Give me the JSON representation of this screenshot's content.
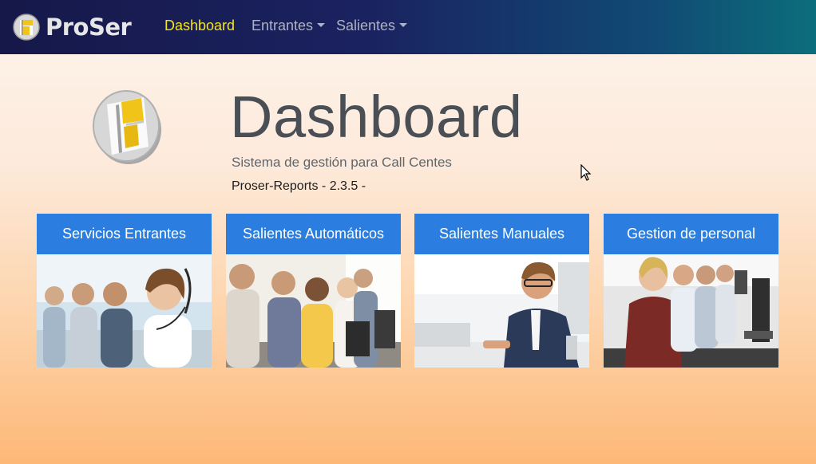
{
  "navbar": {
    "brand": "ProSer",
    "links": [
      {
        "label": "Dashboard",
        "active": true
      },
      {
        "label": "Entrantes",
        "dropdown": true
      },
      {
        "label": "Salientes",
        "dropdown": true
      }
    ]
  },
  "hero": {
    "title": "Dashboard",
    "subtitle": "Sistema de gestión para Call Centes",
    "version": "Proser-Reports - 2.3.5 -"
  },
  "cards": [
    {
      "label": "Servicios Entrantes"
    },
    {
      "label": "Salientes Automáticos"
    },
    {
      "label": "Salientes Manuales"
    },
    {
      "label": "Gestion de personal"
    }
  ],
  "colors": {
    "accent": "#2b7de0",
    "active_nav": "#f3e51a",
    "logo_yellow": "#f0c419"
  }
}
